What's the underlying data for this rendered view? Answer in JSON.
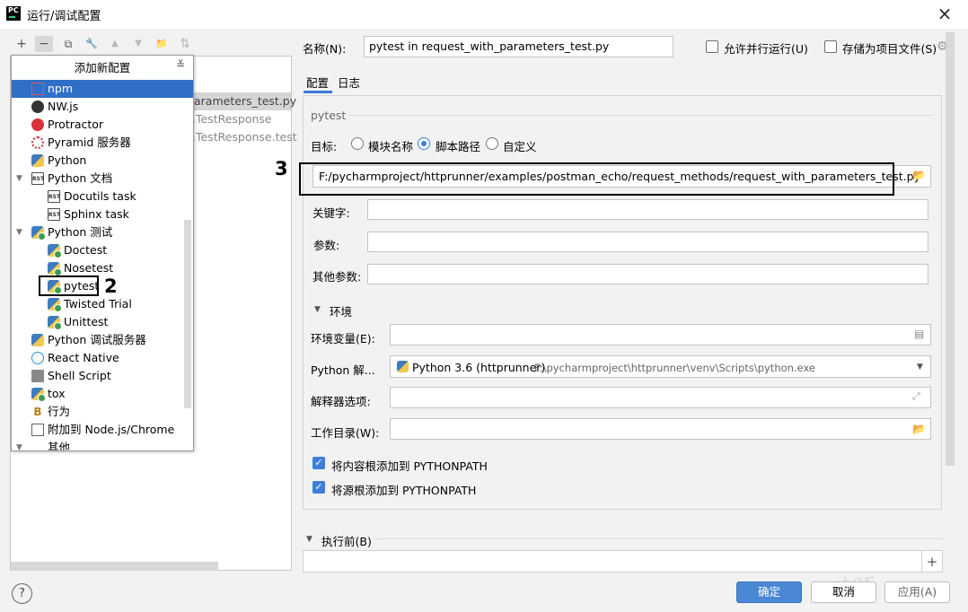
{
  "window": {
    "title": "运行/调试配置",
    "logo_text": "PC"
  },
  "toolbar": {
    "add": "+",
    "remove": "−",
    "copy": "⧉",
    "edit": "🔧",
    "up": "▲",
    "down": "▼",
    "folder": "📁",
    "sort": "⇅"
  },
  "left_tree_ghost": {
    "row1": "arameters_test.py",
    "row2": ".TestResponse",
    "row3": ".TestResponse.test"
  },
  "popup": {
    "header": "添加新配置",
    "items": [
      {
        "label": "npm",
        "icon": "npm-icon",
        "selected": true
      },
      {
        "label": "NW.js",
        "icon": "nwjs-icon"
      },
      {
        "label": "Protractor",
        "icon": "protractor-icon"
      },
      {
        "label": "Pyramid 服务器",
        "icon": "pyramid-icon"
      },
      {
        "label": "Python",
        "icon": "python-icon"
      },
      {
        "label": "Python 文档",
        "icon": "rst-icon",
        "expanded": true
      },
      {
        "label": "Docutils task",
        "icon": "rst-icon",
        "child": true
      },
      {
        "label": "Sphinx task",
        "icon": "rst-icon",
        "child": true
      },
      {
        "label": "Python 测试",
        "icon": "python-test-icon",
        "expanded": true
      },
      {
        "label": "Doctest",
        "icon": "python-test-icon",
        "child": true
      },
      {
        "label": "Nosetest",
        "icon": "python-test-icon",
        "child": true
      },
      {
        "label": "pytest",
        "icon": "python-test-icon",
        "child": true
      },
      {
        "label": "Twisted Trial",
        "icon": "python-test-icon",
        "child": true
      },
      {
        "label": "Unittest",
        "icon": "python-test-icon",
        "child": true
      },
      {
        "label": "Python 调试服务器",
        "icon": "python-debug-icon"
      },
      {
        "label": "React Native",
        "icon": "react-icon"
      },
      {
        "label": "Shell Script",
        "icon": "shell-icon"
      },
      {
        "label": "tox",
        "icon": "python-test-icon"
      },
      {
        "label": "行为",
        "icon": "behave-icon"
      },
      {
        "label": "附加到 Node.js/Chrome",
        "icon": "attach-icon"
      },
      {
        "label": "其他",
        "icon": "",
        "expanded": true
      }
    ]
  },
  "annotations": {
    "two": "2",
    "three": "3"
  },
  "form": {
    "name_label": "名称(N):",
    "name_value": "pytest in request_with_parameters_test.py",
    "allow_parallel": "允许并行运行(U)",
    "store_as_file": "存储为项目文件(S)",
    "tab_config": "配置",
    "tab_log": "日志",
    "section_pytest": "pytest",
    "target_label": "目标:",
    "target_module": "模块名称",
    "target_script": "脚本路径",
    "target_custom": "自定义",
    "script_path": "F:/pycharmproject/httprunner/examples/postman_echo/request_methods/request_with_parameters_test.py",
    "keywords_label": "关键字:",
    "params_label": "参数:",
    "other_params_label": "其他参数:",
    "env_section": "环境",
    "env_vars_label": "环境变量(E):",
    "interpreter_label": "Python 解...",
    "interpreter_name": "Python 3.6 (httprunner)",
    "interpreter_path": "F:\\pycharmproject\\httprunner\\venv\\Scripts\\python.exe",
    "interp_options_label": "解释器选项:",
    "workdir_label": "工作目录(W):",
    "add_content_roots": "将内容根添加到 PYTHONPATH",
    "add_source_roots": "将源根添加到 PYTHONPATH",
    "before_launch": "执行前(B)"
  },
  "buttons": {
    "ok": "确定",
    "cancel": "取消",
    "apply": "应用(A)",
    "help": "?"
  },
  "colors": {
    "accent": "#2f6fc7",
    "button_primary": "#4a88d6"
  }
}
